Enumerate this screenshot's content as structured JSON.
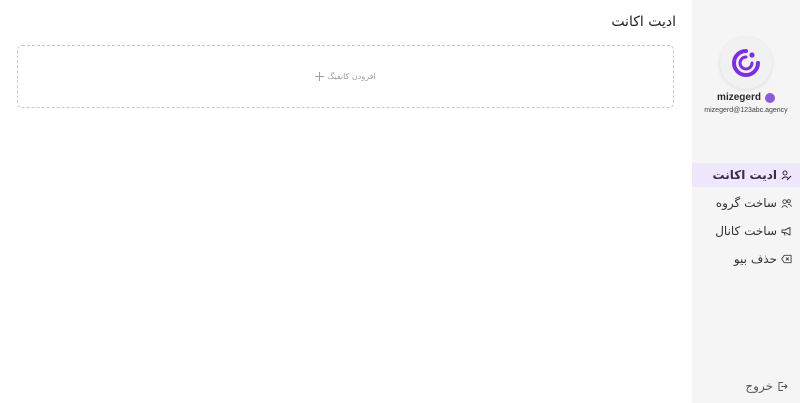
{
  "page": {
    "title": "ادیت اکانت"
  },
  "dropzone": {
    "label": "افزودن کانفیگ",
    "icon": "plus-icon"
  },
  "profile": {
    "username": "mizegerd",
    "email": "mizegerd@123abc.agency",
    "status_color": "#8b5cd6",
    "avatar_icon": "logo-icon"
  },
  "menu": {
    "items": [
      {
        "label": "ادیت اکانت",
        "icon": "user-edit-icon",
        "active": true
      },
      {
        "label": "ساخت گروه",
        "icon": "group-icon",
        "active": false
      },
      {
        "label": "ساخت کانال",
        "icon": "megaphone-icon",
        "active": false
      },
      {
        "label": "حذف بیو",
        "icon": "delete-tag-icon",
        "active": false
      }
    ],
    "logout_label": "خروج",
    "logout_icon": "logout-icon"
  },
  "colors": {
    "accent": "#8b5cd6",
    "logo": "#7c2ee0",
    "active_bg": "#efe7fb",
    "sidebar_bg": "#f5f5f5"
  }
}
